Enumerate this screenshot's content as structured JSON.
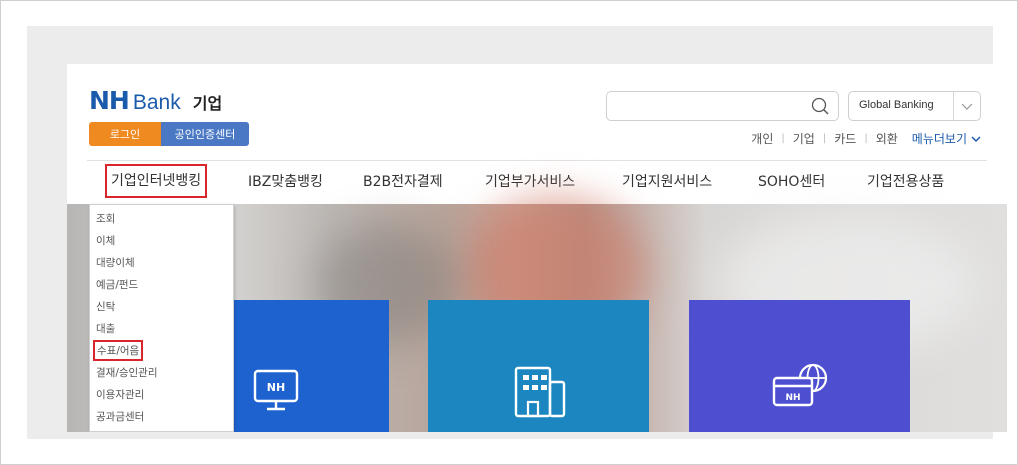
{
  "logo": {
    "nh": "NH",
    "bank": "Bank",
    "segment": "기업"
  },
  "auth": {
    "login_label": "로그인",
    "cert_label": "공인인증센터"
  },
  "search": {
    "placeholder": "",
    "icon": "search-icon"
  },
  "global": {
    "label": "Global Banking"
  },
  "util_links": [
    "개인",
    "기업",
    "카드",
    "외환"
  ],
  "menu_more": "메뉴더보기",
  "gnb": [
    "기업인터넷뱅킹",
    "IBZ맞춤뱅킹",
    "B2B전자결제",
    "기업부가서비스",
    "기업지원서비스",
    "SOHO센터",
    "기업전용상품"
  ],
  "gnb_active_index": 0,
  "dropdown": [
    "조회",
    "이체",
    "대량이체",
    "예금/펀드",
    "신탁",
    "대출",
    "수표/어음",
    "결재/승인관리",
    "이용자관리",
    "공과금센터"
  ],
  "dropdown_active_index": 6,
  "cards": [
    {
      "icon": "nh-monitor-icon",
      "icon_text": "NH",
      "color": "#1e62d0"
    },
    {
      "icon": "building-icon",
      "color": "#1b86bf"
    },
    {
      "icon": "nh-card-globe-icon",
      "icon_text": "NH",
      "color": "#4d4fd0"
    }
  ],
  "colors": {
    "brand_blue": "#1a5bab",
    "login_orange": "#ee8a1f",
    "cert_blue": "#4a78c4",
    "highlight_red": "#d9262c"
  }
}
